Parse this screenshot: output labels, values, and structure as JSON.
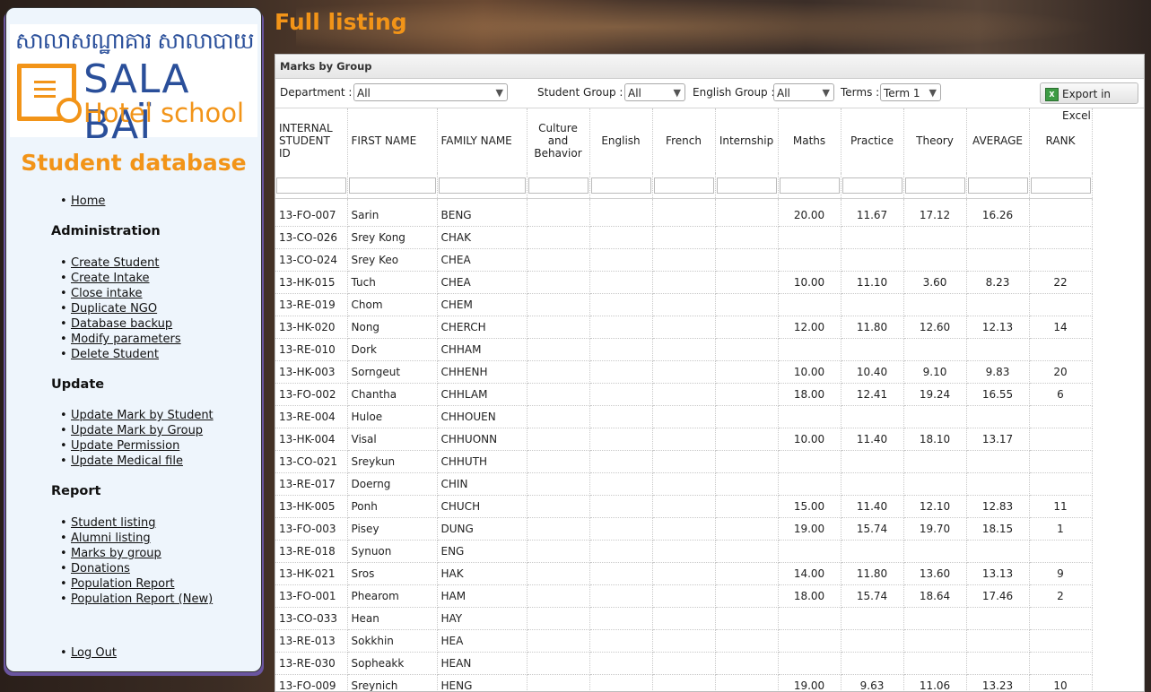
{
  "logo": {
    "khmer": "សាលាសណ្ឋាគារ សាលាបាយ",
    "name": "SALA BAÏ",
    "sub": "Hotel school"
  },
  "sidebar": {
    "title": "Student database",
    "home": "Home",
    "sections": [
      {
        "title": "Administration",
        "items": [
          "Create Student",
          "Create Intake",
          "Close intake",
          "Duplicate NGO",
          "Database backup",
          "Modify parameters",
          "Delete Student"
        ]
      },
      {
        "title": "Update",
        "items": [
          "Update Mark by Student",
          "Update Mark by Group",
          "Update Permission",
          "Update Medical file"
        ]
      },
      {
        "title": "Report",
        "items": [
          "Student listing",
          "Alumni listing",
          "Marks by group",
          "Donations",
          "Population Report",
          "Population Report (New)"
        ]
      }
    ],
    "logout": "Log Out"
  },
  "main": {
    "title": "Full listing"
  },
  "panel": {
    "title": "Marks by Group",
    "filters": {
      "department_label": "Department :",
      "department_value": "All",
      "student_group_label": "Student Group :",
      "student_group_value": "All",
      "english_group_label": "English Group :",
      "english_group_value": "All",
      "terms_label": "Terms :",
      "terms_value": "Term 1"
    },
    "export_label": "Export in Excel"
  },
  "table": {
    "columns": [
      "INTERNAL STUDENT ID",
      "FIRST NAME",
      "FAMILY NAME",
      "Culture and Behavior",
      "English",
      "French",
      "Internship",
      "Maths",
      "Practice",
      "Theory",
      "AVERAGE",
      "RANK"
    ],
    "rows": [
      [
        "13-FO-007",
        "Sarin",
        "BENG",
        "",
        "",
        "",
        "",
        "20.00",
        "11.67",
        "17.12",
        "16.26",
        ""
      ],
      [
        "13-CO-026",
        "Srey Kong",
        "CHAK",
        "",
        "",
        "",
        "",
        "",
        "",
        "",
        "",
        ""
      ],
      [
        "13-CO-024",
        "Srey Keo",
        "CHEA",
        "",
        "",
        "",
        "",
        "",
        "",
        "",
        "",
        ""
      ],
      [
        "13-HK-015",
        "Tuch",
        "CHEA",
        "",
        "",
        "",
        "",
        "10.00",
        "11.10",
        "3.60",
        "8.23",
        "22"
      ],
      [
        "13-RE-019",
        "Chom",
        "CHEM",
        "",
        "",
        "",
        "",
        "",
        "",
        "",
        "",
        ""
      ],
      [
        "13-HK-020",
        "Nong",
        "CHERCH",
        "",
        "",
        "",
        "",
        "12.00",
        "11.80",
        "12.60",
        "12.13",
        "14"
      ],
      [
        "13-RE-010",
        "Dork",
        "CHHAM",
        "",
        "",
        "",
        "",
        "",
        "",
        "",
        "",
        ""
      ],
      [
        "13-HK-003",
        "Sorngeut",
        "CHHENH",
        "",
        "",
        "",
        "",
        "10.00",
        "10.40",
        "9.10",
        "9.83",
        "20"
      ],
      [
        "13-FO-002",
        "Chantha",
        "CHHLAM",
        "",
        "",
        "",
        "",
        "18.00",
        "12.41",
        "19.24",
        "16.55",
        "6"
      ],
      [
        "13-RE-004",
        "Huloe",
        "CHHOUEN",
        "",
        "",
        "",
        "",
        "",
        "",
        "",
        "",
        ""
      ],
      [
        "13-HK-004",
        "Visal",
        "CHHUONN",
        "",
        "",
        "",
        "",
        "10.00",
        "11.40",
        "18.10",
        "13.17",
        ""
      ],
      [
        "13-CO-021",
        "Sreykun",
        "CHHUTH",
        "",
        "",
        "",
        "",
        "",
        "",
        "",
        "",
        ""
      ],
      [
        "13-RE-017",
        "Doerng",
        "CHIN",
        "",
        "",
        "",
        "",
        "",
        "",
        "",
        "",
        ""
      ],
      [
        "13-HK-005",
        "Ponh",
        "CHUCH",
        "",
        "",
        "",
        "",
        "15.00",
        "11.40",
        "12.10",
        "12.83",
        "11"
      ],
      [
        "13-FO-003",
        "Pisey",
        "DUNG",
        "",
        "",
        "",
        "",
        "19.00",
        "15.74",
        "19.70",
        "18.15",
        "1"
      ],
      [
        "13-RE-018",
        "Synuon",
        "ENG",
        "",
        "",
        "",
        "",
        "",
        "",
        "",
        "",
        ""
      ],
      [
        "13-HK-021",
        "Sros",
        "HAK",
        "",
        "",
        "",
        "",
        "14.00",
        "11.80",
        "13.60",
        "13.13",
        "9"
      ],
      [
        "13-FO-001",
        "Phearom",
        "HAM",
        "",
        "",
        "",
        "",
        "18.00",
        "15.74",
        "18.64",
        "17.46",
        "2"
      ],
      [
        "13-CO-033",
        "Hean",
        "HAY",
        "",
        "",
        "",
        "",
        "",
        "",
        "",
        "",
        ""
      ],
      [
        "13-RE-013",
        "Sokkhin",
        "HEA",
        "",
        "",
        "",
        "",
        "",
        "",
        "",
        "",
        ""
      ],
      [
        "13-RE-030",
        "Sopheakk",
        "HEAN",
        "",
        "",
        "",
        "",
        "",
        "",
        "",
        "",
        ""
      ],
      [
        "13-FO-009",
        "Sreynich",
        "HENG",
        "",
        "",
        "",
        "",
        "19.00",
        "9.63",
        "11.06",
        "13.23",
        "10"
      ]
    ]
  },
  "colors": {
    "accent": "#f29418",
    "brand_blue": "#2a4f9a",
    "sidebar_bg": "#eef5fc"
  }
}
